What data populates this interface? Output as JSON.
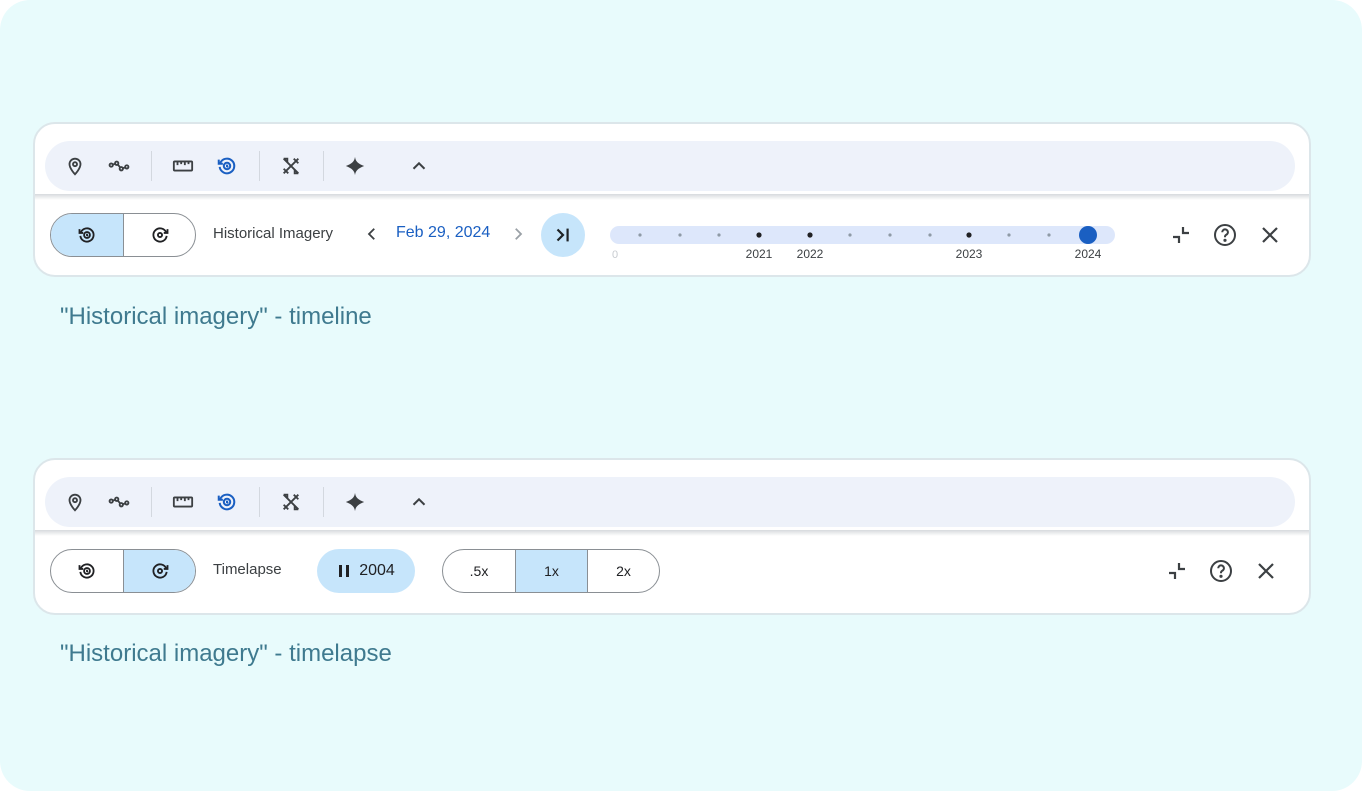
{
  "colors": {
    "background": "#e8fbfc",
    "accent": "#1a5fc2",
    "selected_fill": "#c6e5fb",
    "caption": "#3f7a8f"
  },
  "toolbar_icons": [
    "pin-icon",
    "path-icon",
    "ruler-icon",
    "history-icon",
    "tools-icon",
    "sparkle-icon",
    "chevron-up-icon"
  ],
  "timeline_panel": {
    "mode_toggle": {
      "selected": "historical"
    },
    "label": "Historical Imagery",
    "date": "Feb 29, 2024",
    "timeline": {
      "start_label": "0",
      "year_labels": [
        "2021",
        "2022",
        "2023",
        "2024"
      ],
      "selected_year": "2024"
    },
    "caption": "\"Historical imagery\" - timeline"
  },
  "timelapse_panel": {
    "mode_toggle": {
      "selected": "timelapse"
    },
    "label": "Timelapse",
    "play_year": "2004",
    "speeds": [
      ".5x",
      "1x",
      "2x"
    ],
    "selected_speed": "1x",
    "caption": "\"Historical imagery\" - timelapse"
  }
}
